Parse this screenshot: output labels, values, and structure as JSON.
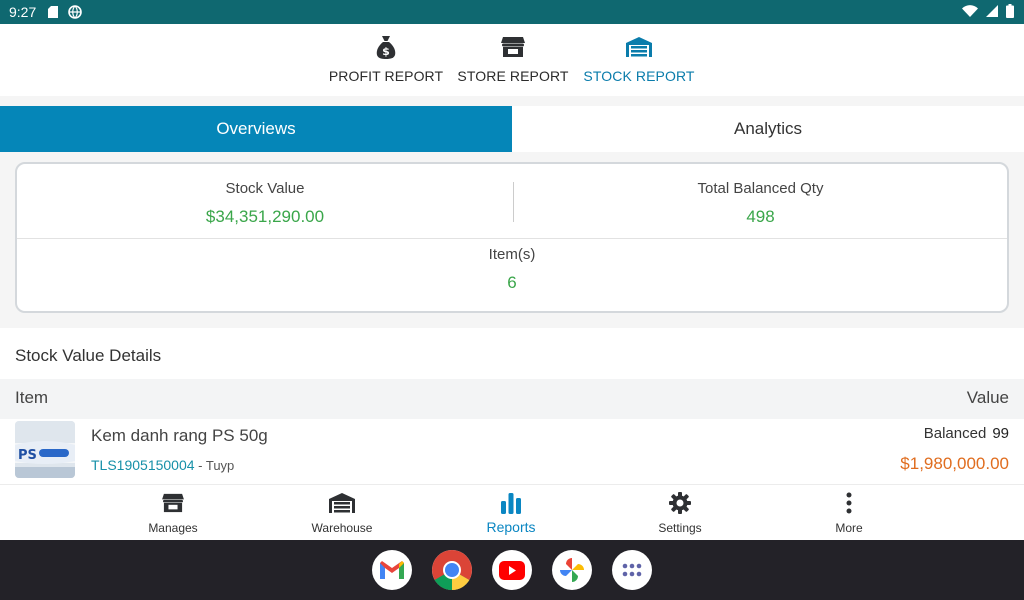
{
  "status_bar": {
    "time": "9:27"
  },
  "report_tabs": [
    {
      "label": "PROFIT REPORT",
      "icon": "money-bag-icon"
    },
    {
      "label": "STORE REPORT",
      "icon": "store-icon"
    },
    {
      "label": "STOCK REPORT",
      "icon": "warehouse-icon",
      "active": true
    }
  ],
  "view_tabs": {
    "overviews": "Overviews",
    "analytics": "Analytics",
    "active": "Overviews"
  },
  "summary": {
    "stock_value": {
      "label": "Stock Value",
      "value": "$34,351,290.00"
    },
    "total_balanced_qty": {
      "label": "Total Balanced Qty",
      "value": "498"
    },
    "items": {
      "label": "Item(s)",
      "value": "6"
    }
  },
  "details": {
    "title": "Stock Value Details",
    "columns": {
      "item": "Item",
      "value": "Value"
    },
    "rows": [
      {
        "name": "Kem danh rang PS 50g",
        "code": "TLS1905150004",
        "unit": " - Tuyp",
        "balanced_label": "Balanced",
        "balanced_qty": "99",
        "value": "$1,980,000.00"
      }
    ]
  },
  "bottom_nav": [
    {
      "label": "Manages",
      "icon": "store-icon"
    },
    {
      "label": "Warehouse",
      "icon": "warehouse-icon"
    },
    {
      "label": "Reports",
      "icon": "bar-chart-icon",
      "active": true
    },
    {
      "label": "Settings",
      "icon": "gear-icon"
    },
    {
      "label": "More",
      "icon": "more-vertical-icon"
    }
  ],
  "dock_apps": [
    "gmail-icon",
    "chrome-icon",
    "youtube-icon",
    "photos-icon",
    "app-drawer-icon"
  ],
  "colors": {
    "status_bar": "#0f6870",
    "accent": "#0586b8",
    "positive": "#3aa64a",
    "money": "#e06d1f",
    "link": "#1690a8"
  }
}
